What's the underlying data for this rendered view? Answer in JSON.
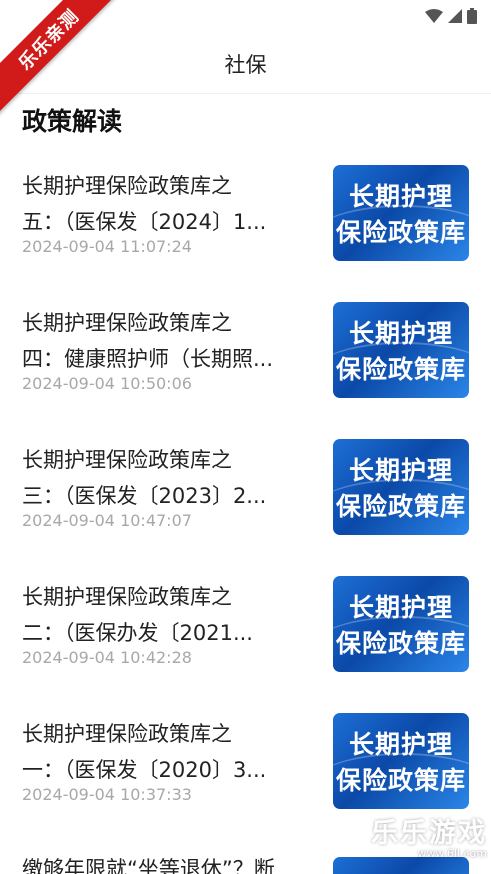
{
  "app": {
    "title": "社保",
    "watermark_top": "乐乐亲测",
    "watermark_bottom": "乐乐游戏",
    "watermark_bottom_url": "www.6ll.com"
  },
  "section": {
    "title": "政策解读"
  },
  "thumbnail": {
    "line1": "长期护理",
    "line2": "保险政策库"
  },
  "articles": [
    {
      "line1": "长期护理保险政策库之",
      "line2": "五：（医保发〔2024〕1...",
      "time": "2024-09-04 11:07:24"
    },
    {
      "line1": "长期护理保险政策库之",
      "line2": "四：健康照护师（长期照...",
      "time": "2024-09-04 10:50:06"
    },
    {
      "line1": "长期护理保险政策库之",
      "line2": "三：（医保发〔2023〕2...",
      "time": "2024-09-04 10:47:07"
    },
    {
      "line1": "长期护理保险政策库之",
      "line2": "二：（医保办发〔2021...",
      "time": "2024-09-04 10:42:28"
    },
    {
      "line1": "长期护理保险政策库之",
      "line2": "一：（医保发〔2020〕3...",
      "time": "2024-09-04 10:37:33"
    },
    {
      "line1": "缴够年限就“坐等退休”？断"
    }
  ],
  "colors": {
    "accent_badge": "#d11b1b",
    "thumb_blue": "#0b49a8",
    "time_gray": "#a8a8a8"
  }
}
